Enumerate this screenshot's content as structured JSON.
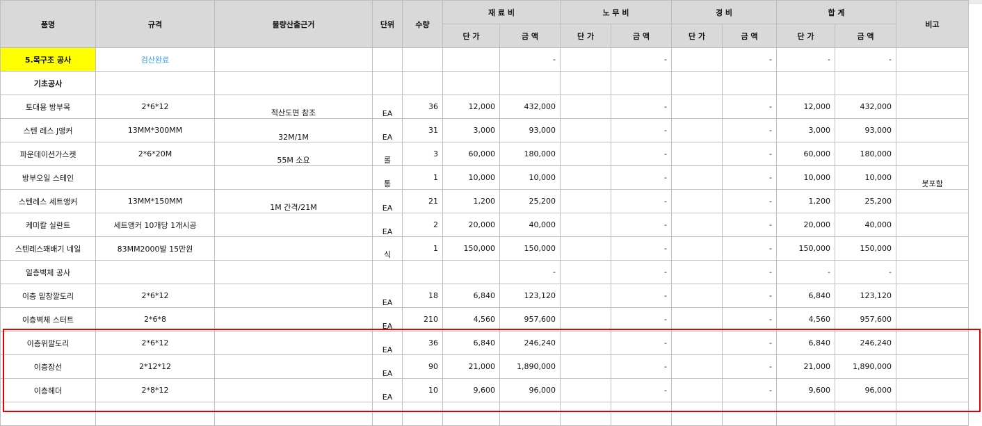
{
  "header": {
    "name": "품명",
    "spec": "규격",
    "basis": "물량산출근거",
    "unit": "단위",
    "qty": "수량",
    "material": "재 료 비",
    "labor": "노 무 비",
    "expense": "경       비",
    "total": "합       계",
    "note": "비고",
    "unit_price": "단 가",
    "amount": "금  액"
  },
  "rows": [
    {
      "name": "5.목구조 공사",
      "spec": "검산완료",
      "basis": "",
      "unit": "",
      "qty": "",
      "m_up": "",
      "m_amt": "-",
      "l_up": "",
      "l_amt": "-",
      "e_up": "",
      "e_amt": "-",
      "t_up": "-",
      "t_amt": "-",
      "note": "",
      "style": "section"
    },
    {
      "name": "기초공사",
      "spec": "",
      "basis": "",
      "unit": "",
      "qty": "",
      "m_up": "",
      "m_amt": "",
      "l_up": "",
      "l_amt": "",
      "e_up": "",
      "e_amt": "",
      "t_up": "",
      "t_amt": "",
      "note": "",
      "style": "bold"
    },
    {
      "name": "토대용 방부목",
      "spec": "2*6*12",
      "basis": "적산도면 참조",
      "unit": "EA",
      "qty": "36",
      "m_up": "12,000",
      "m_amt": "432,000",
      "l_up": "",
      "l_amt": "-",
      "e_up": "",
      "e_amt": "-",
      "t_up": "12,000",
      "t_amt": "432,000",
      "note": ""
    },
    {
      "name": "스텐 레스 J앵커",
      "spec": "13MM*300MM",
      "basis": "32M/1M",
      "unit": "EA",
      "qty": "31",
      "m_up": "3,000",
      "m_amt": "93,000",
      "l_up": "",
      "l_amt": "-",
      "e_up": "",
      "e_amt": "-",
      "t_up": "3,000",
      "t_amt": "93,000",
      "note": ""
    },
    {
      "name": "파운데이션가스켓",
      "spec": "2*6*20M",
      "basis": "55M 소요",
      "unit": "롤",
      "qty": "3",
      "m_up": "60,000",
      "m_amt": "180,000",
      "l_up": "",
      "l_amt": "-",
      "e_up": "",
      "e_amt": "-",
      "t_up": "60,000",
      "t_amt": "180,000",
      "note": ""
    },
    {
      "name": "방부오일 스테인",
      "spec": "",
      "basis": "",
      "unit": "통",
      "qty": "1",
      "m_up": "10,000",
      "m_amt": "10,000",
      "l_up": "",
      "l_amt": "-",
      "e_up": "",
      "e_amt": "-",
      "t_up": "10,000",
      "t_amt": "10,000",
      "note": "붓포함"
    },
    {
      "name": "스텐레스 세트앵커",
      "spec": "13MM*150MM",
      "basis": "1M 간격/21M",
      "unit": "EA",
      "qty": "21",
      "m_up": "1,200",
      "m_amt": "25,200",
      "l_up": "",
      "l_amt": "-",
      "e_up": "",
      "e_amt": "-",
      "t_up": "1,200",
      "t_amt": "25,200",
      "note": ""
    },
    {
      "name": "케미칼 실란트",
      "spec": "세트앵커  10개당  1개시공",
      "basis": "",
      "unit": "EA",
      "qty": "2",
      "m_up": "20,000",
      "m_amt": "40,000",
      "l_up": "",
      "l_amt": "-",
      "e_up": "",
      "e_amt": "-",
      "t_up": "20,000",
      "t_amt": "40,000",
      "note": ""
    },
    {
      "name": "스텐레스꽤배기 네일",
      "spec": "83MM2000발 15만원",
      "basis": "",
      "unit": "식",
      "qty": "1",
      "m_up": "150,000",
      "m_amt": "150,000",
      "l_up": "",
      "l_amt": "-",
      "e_up": "",
      "e_amt": "-",
      "t_up": "150,000",
      "t_amt": "150,000",
      "note": ""
    },
    {
      "name": "일층벽체 공사",
      "spec": "",
      "basis": "",
      "unit": "",
      "qty": "",
      "m_up": "",
      "m_amt": "-",
      "l_up": "",
      "l_amt": "-",
      "e_up": "",
      "e_amt": "-",
      "t_up": "-",
      "t_amt": "-",
      "note": ""
    },
    {
      "name": "이층 밑창깔도리",
      "spec": "2*6*12",
      "basis": "",
      "unit": "EA",
      "qty": "18",
      "m_up": "6,840",
      "m_amt": "123,120",
      "l_up": "",
      "l_amt": "-",
      "e_up": "",
      "e_amt": "-",
      "t_up": "6,840",
      "t_amt": "123,120",
      "note": ""
    },
    {
      "name": "이층벽체 스터트",
      "spec": "2*6*8",
      "basis": "",
      "unit": "EA",
      "qty": "210",
      "m_up": "4,560",
      "m_amt": "957,600",
      "l_up": "",
      "l_amt": "-",
      "e_up": "",
      "e_amt": "-",
      "t_up": "4,560",
      "t_amt": "957,600",
      "note": ""
    },
    {
      "name": "이층위깔도리",
      "spec": "2*6*12",
      "basis": "",
      "unit": "EA",
      "qty": "36",
      "m_up": "6,840",
      "m_amt": "246,240",
      "l_up": "",
      "l_amt": "-",
      "e_up": "",
      "e_amt": "-",
      "t_up": "6,840",
      "t_amt": "246,240",
      "note": ""
    },
    {
      "name": "이층장선",
      "spec": "2*12*12",
      "basis": "",
      "unit": "EA",
      "qty": "90",
      "m_up": "21,000",
      "m_amt": "1,890,000",
      "l_up": "",
      "l_amt": "-",
      "e_up": "",
      "e_amt": "-",
      "t_up": "21,000",
      "t_amt": "1,890,000",
      "note": ""
    },
    {
      "name": "이층헤더",
      "spec": "2*8*12",
      "basis": "",
      "unit": "EA",
      "qty": "10",
      "m_up": "9,600",
      "m_amt": "96,000",
      "l_up": "",
      "l_amt": "-",
      "e_up": "",
      "e_amt": "-",
      "t_up": "9,600",
      "t_amt": "96,000",
      "note": ""
    },
    {
      "name": "",
      "spec": "",
      "basis": "",
      "unit": "",
      "qty": "",
      "m_up": "",
      "m_amt": "",
      "l_up": "",
      "l_amt": "",
      "e_up": "",
      "e_amt": "",
      "t_up": "",
      "t_amt": "",
      "note": ""
    }
  ],
  "colors": {
    "highlight_border": "#e00000",
    "header_bg": "#d9d9d9",
    "section_bg": "#ffff00",
    "verified_text": "#3399ff"
  }
}
